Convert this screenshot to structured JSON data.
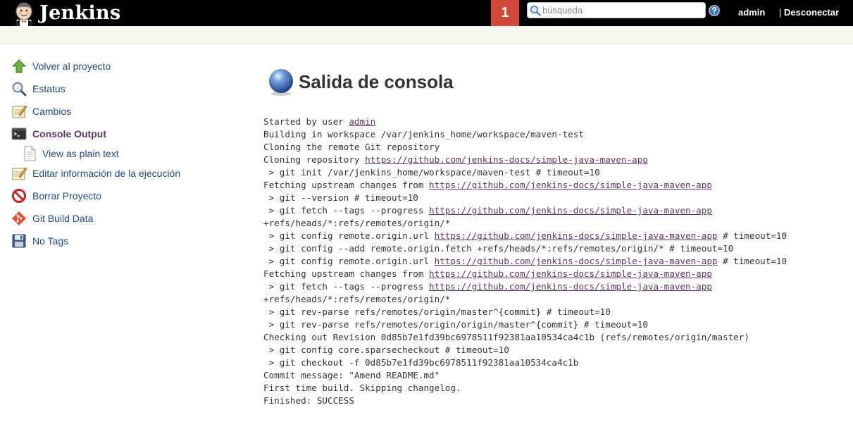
{
  "header": {
    "brand": "Jenkins",
    "notification_count": "1",
    "search_placeholder": "búsqueda",
    "user": "admin",
    "logout_separator": "| ",
    "logout_label": "Desconectar",
    "accent_color": "#d24939"
  },
  "sidebar": {
    "items": [
      {
        "label": "Volver al proyecto",
        "icon": "up-arrow-icon"
      },
      {
        "label": "Estatus",
        "icon": "magnifier-icon"
      },
      {
        "label": "Cambios",
        "icon": "notepad-icon"
      },
      {
        "label": "Console Output",
        "icon": "terminal-icon",
        "current": true
      },
      {
        "label": "View as plain text",
        "icon": "document-icon",
        "sub": true
      },
      {
        "label": "Editar información de la ejecución",
        "icon": "notepad-icon"
      },
      {
        "label": "Borrar Proyecto",
        "icon": "no-entry-icon"
      },
      {
        "label": "Git Build Data",
        "icon": "git-icon"
      },
      {
        "label": "No Tags",
        "icon": "save-icon"
      }
    ]
  },
  "main": {
    "title": "Salida de consola",
    "console_lines": [
      [
        {
          "t": "Started by user "
        },
        {
          "t": "admin",
          "link": true
        }
      ],
      [
        {
          "t": "Building in workspace /var/jenkins_home/workspace/maven-test"
        }
      ],
      [
        {
          "t": "Cloning the remote Git repository"
        }
      ],
      [
        {
          "t": "Cloning repository "
        },
        {
          "t": "https://github.com/jenkins-docs/simple-java-maven-app",
          "link": true
        }
      ],
      [
        {
          "t": " > git init /var/jenkins_home/workspace/maven-test # timeout=10"
        }
      ],
      [
        {
          "t": "Fetching upstream changes from "
        },
        {
          "t": "https://github.com/jenkins-docs/simple-java-maven-app",
          "link": true
        }
      ],
      [
        {
          "t": " > git --version # timeout=10"
        }
      ],
      [
        {
          "t": " > git fetch --tags --progress "
        },
        {
          "t": "https://github.com/jenkins-docs/simple-java-maven-app",
          "link": true
        }
      ],
      [
        {
          "t": "+refs/heads/*:refs/remotes/origin/*"
        }
      ],
      [
        {
          "t": " > git config remote.origin.url "
        },
        {
          "t": "https://github.com/jenkins-docs/simple-java-maven-app",
          "link": true
        },
        {
          "t": " # timeout=10"
        }
      ],
      [
        {
          "t": " > git config --add remote.origin.fetch +refs/heads/*:refs/remotes/origin/* # timeout=10"
        }
      ],
      [
        {
          "t": " > git config remote.origin.url "
        },
        {
          "t": "https://github.com/jenkins-docs/simple-java-maven-app",
          "link": true
        },
        {
          "t": " # timeout=10"
        }
      ],
      [
        {
          "t": "Fetching upstream changes from "
        },
        {
          "t": "https://github.com/jenkins-docs/simple-java-maven-app",
          "link": true
        }
      ],
      [
        {
          "t": " > git fetch --tags --progress "
        },
        {
          "t": "https://github.com/jenkins-docs/simple-java-maven-app",
          "link": true
        }
      ],
      [
        {
          "t": "+refs/heads/*:refs/remotes/origin/*"
        }
      ],
      [
        {
          "t": " > git rev-parse refs/remotes/origin/master^{commit} # timeout=10"
        }
      ],
      [
        {
          "t": " > git rev-parse refs/remotes/origin/origin/master^{commit} # timeout=10"
        }
      ],
      [
        {
          "t": "Checking out Revision 0d85b7e1fd39bc6978511f92381aa10534ca4c1b (refs/remotes/origin/master)"
        }
      ],
      [
        {
          "t": " > git config core.sparsecheckout # timeout=10"
        }
      ],
      [
        {
          "t": " > git checkout -f 0d85b7e1fd39bc6978511f92381aa10534ca4c1b"
        }
      ],
      [
        {
          "t": "Commit message: \"Amend README.md\""
        }
      ],
      [
        {
          "t": "First time build. Skipping changelog."
        }
      ],
      [
        {
          "t": "Finished: SUCCESS"
        }
      ]
    ]
  }
}
